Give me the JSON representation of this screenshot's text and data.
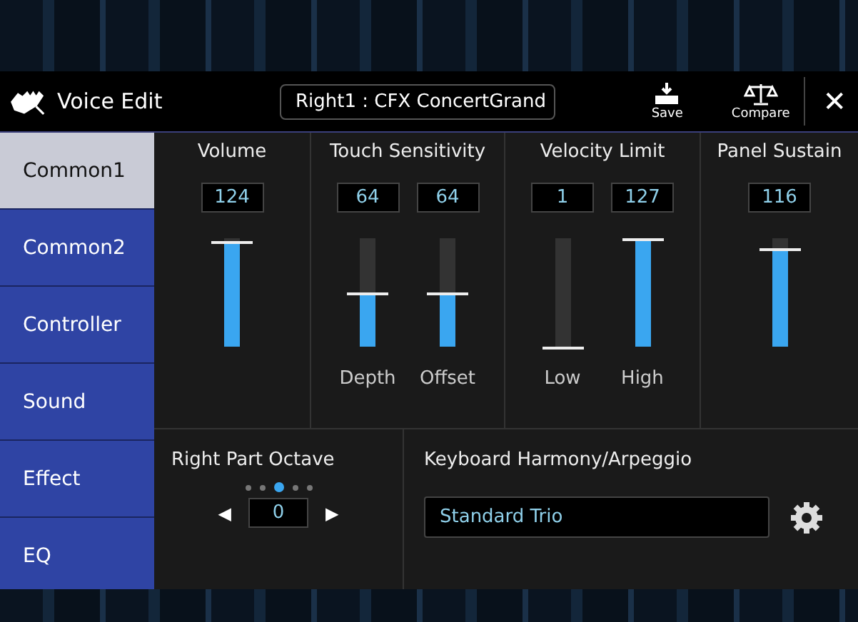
{
  "header": {
    "title": "Voice Edit",
    "voice_name": "Right1 : CFX ConcertGrand",
    "actions": [
      {
        "kind": "save",
        "label": "Save"
      },
      {
        "kind": "compare",
        "label": "Compare"
      },
      {
        "kind": "close",
        "label": "✕"
      }
    ]
  },
  "sidebar": {
    "items": [
      {
        "label": "Common1",
        "selected": true
      },
      {
        "label": "Common2",
        "selected": false
      },
      {
        "label": "Controller",
        "selected": false
      },
      {
        "label": "Sound",
        "selected": false
      },
      {
        "label": "Effect",
        "selected": false
      },
      {
        "label": "EQ",
        "selected": false
      }
    ]
  },
  "panels": [
    {
      "title": "Volume",
      "sliders": [
        {
          "value": "124",
          "level": 0.98
        }
      ]
    },
    {
      "title": "Touch Sensitivity",
      "sliders": [
        {
          "value": "64",
          "level": 0.5,
          "label": "Depth"
        },
        {
          "value": "64",
          "level": 0.5,
          "label": "Offset"
        }
      ]
    },
    {
      "title": "Velocity Limit",
      "sliders": [
        {
          "value": "1",
          "level": 0.0,
          "label": "Low"
        },
        {
          "value": "127",
          "level": 1.0,
          "label": "High"
        }
      ]
    },
    {
      "title": "Panel Sustain",
      "sliders": [
        {
          "value": "116",
          "level": 0.91
        }
      ]
    }
  ],
  "octave": {
    "title": "Right Part Octave",
    "dots": [
      {
        "selected": false
      },
      {
        "selected": false
      },
      {
        "selected": true
      },
      {
        "selected": false
      },
      {
        "selected": false
      }
    ],
    "left": "◀",
    "value": "0",
    "right": "▶"
  },
  "harmony": {
    "title": "Keyboard Harmony/Arpeggio",
    "value": "Standard Trio"
  }
}
